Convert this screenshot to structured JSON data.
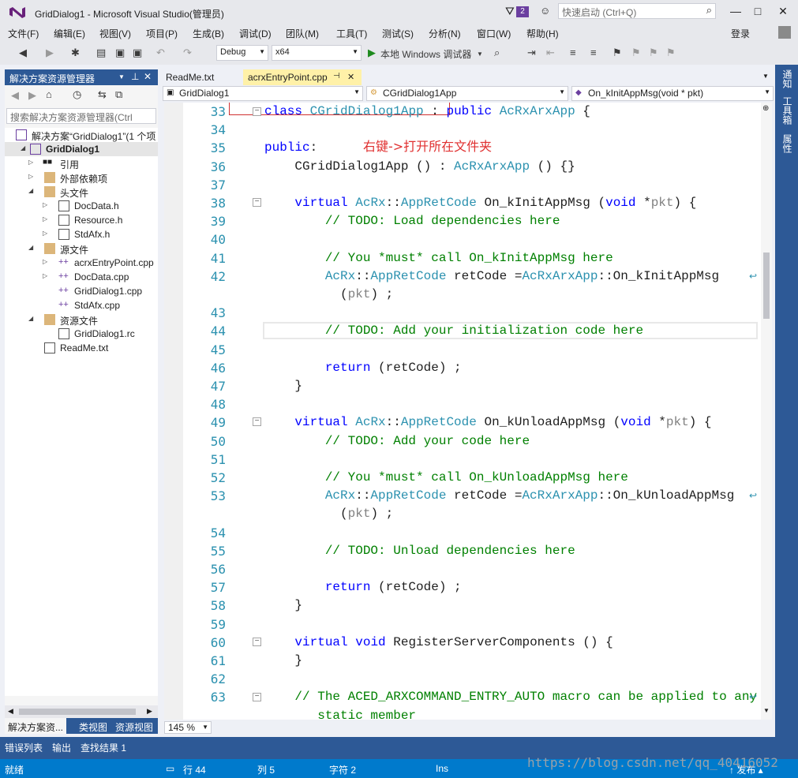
{
  "titlebar": {
    "title": "GridDialog1 - Microsoft Visual Studio(管理员)",
    "notification_count": "2",
    "quick_launch_placeholder": "快速启动 (Ctrl+Q)",
    "minimize": "—",
    "restore": "□",
    "close": "✕"
  },
  "menu": {
    "items": [
      "文件(F)",
      "编辑(E)",
      "视图(V)",
      "项目(P)",
      "生成(B)",
      "调试(D)",
      "团队(M)",
      "工具(T)",
      "测试(S)",
      "分析(N)",
      "窗口(W)",
      "帮助(H)"
    ],
    "login": "登录"
  },
  "toolbar": {
    "config": "Debug",
    "platform": "x64",
    "run_label": "本地 Windows 调试器"
  },
  "solution_explorer": {
    "title": "解决方案资源管理器",
    "search_placeholder": "搜索解决方案资源管理器(Ctrl",
    "items": [
      {
        "label": "解决方案“GridDialog1”(1 个项"
      },
      {
        "label": "GridDialog1"
      },
      {
        "label": "引用"
      },
      {
        "label": "外部依赖项"
      },
      {
        "label": "头文件"
      },
      {
        "label": "DocData.h"
      },
      {
        "label": "Resource.h"
      },
      {
        "label": "StdAfx.h"
      },
      {
        "label": "源文件"
      },
      {
        "label": "acrxEntryPoint.cpp"
      },
      {
        "label": "DocData.cpp"
      },
      {
        "label": "GridDialog1.cpp"
      },
      {
        "label": "StdAfx.cpp"
      },
      {
        "label": "资源文件"
      },
      {
        "label": "GridDialog1.rc"
      },
      {
        "label": "ReadMe.txt"
      }
    ],
    "tabs": [
      "解决方案资...",
      "类视图",
      "资源视图"
    ]
  },
  "editor": {
    "tabs": [
      "ReadMe.txt",
      "acrxEntryPoint.cpp"
    ],
    "nav_project": "GridDialog1",
    "nav_class": "CGridDialog1App",
    "nav_member": "On_kInitAppMsg(void * pkt)",
    "annotation": "右键->打开所在文件夹",
    "zoom": "145 %",
    "line_numbers": [
      "33",
      "34",
      "35",
      "36",
      "37",
      "38",
      "39",
      "40",
      "41",
      "42",
      "43",
      "44",
      "45",
      "46",
      "47",
      "48",
      "49",
      "50",
      "51",
      "52",
      "53",
      "54",
      "55",
      "56",
      "57",
      "58",
      "59",
      "60",
      "61",
      "62",
      "63"
    ]
  },
  "right_strip": [
    "通知",
    "工具箱",
    "属性"
  ],
  "bottom_tabs": [
    "错误列表",
    "输出",
    "查找结果 1"
  ],
  "status": {
    "ready": "就绪",
    "row": "行 44",
    "col": "列 5",
    "char": "字符 2",
    "ins": "Ins",
    "publish": "↑ 发布 ▴"
  },
  "watermark": "https://blog.csdn.net/qq_40416052"
}
